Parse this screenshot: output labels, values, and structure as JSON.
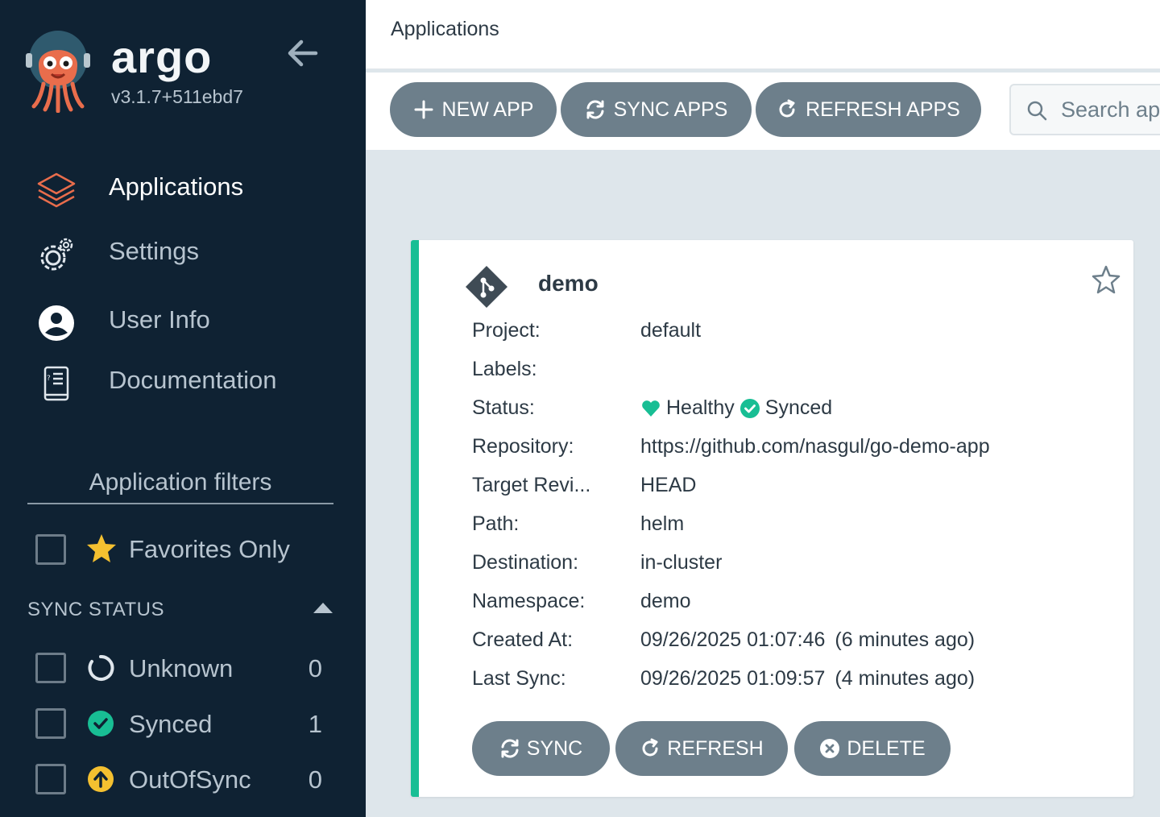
{
  "sidebar": {
    "brand": "argo",
    "version": "v3.1.7+511ebd7",
    "nav": [
      {
        "label": "Applications",
        "icon": "layers-icon",
        "active": true
      },
      {
        "label": "Settings",
        "icon": "gear-icon"
      },
      {
        "label": "User Info",
        "icon": "user-icon"
      },
      {
        "label": "Documentation",
        "icon": "docs-icon"
      }
    ],
    "filters_title": "Application filters",
    "favorites_label": "Favorites Only",
    "sync_status_header": "SYNC STATUS",
    "sync_status": [
      {
        "label": "Unknown",
        "count": "0",
        "icon": "circle-notch-icon"
      },
      {
        "label": "Synced",
        "count": "1",
        "icon": "check-circle-icon"
      },
      {
        "label": "OutOfSync",
        "count": "0",
        "icon": "arrow-up-circle-icon"
      }
    ]
  },
  "header": {
    "title": "Applications"
  },
  "toolbar": {
    "new_app": "NEW APP",
    "sync_apps": "SYNC APPS",
    "refresh_apps": "REFRESH APPS",
    "search_placeholder": "Search applications..."
  },
  "app": {
    "name": "demo",
    "fields": {
      "project": {
        "label": "Project:",
        "value": "default"
      },
      "labels": {
        "label": "Labels:",
        "value": ""
      },
      "status": {
        "label": "Status:",
        "health": "Healthy",
        "sync": "Synced"
      },
      "repository": {
        "label": "Repository:",
        "value": "https://github.com/nasgul/go-demo-app"
      },
      "target_revision": {
        "label": "Target Revi...",
        "value": "HEAD"
      },
      "path": {
        "label": "Path:",
        "value": "helm"
      },
      "destination": {
        "label": "Destination:",
        "value": "in-cluster"
      },
      "namespace": {
        "label": "Namespace:",
        "value": "demo"
      },
      "created_at": {
        "label": "Created At:",
        "value": "09/26/2025 01:07:46",
        "ago": "(6 minutes ago)"
      },
      "last_sync": {
        "label": "Last Sync:",
        "value": "09/26/2025 01:09:57",
        "ago": "(4 minutes ago)"
      }
    },
    "buttons": {
      "sync": "SYNC",
      "refresh": "REFRESH",
      "delete": "DELETE"
    }
  },
  "colors": {
    "sidebar_bg": "#0f2233",
    "button_gray": "#6d7f8b",
    "healthy_green": "#18be94",
    "outofsync_yellow": "#f4c030",
    "argo_orange": "#e96d4c"
  }
}
